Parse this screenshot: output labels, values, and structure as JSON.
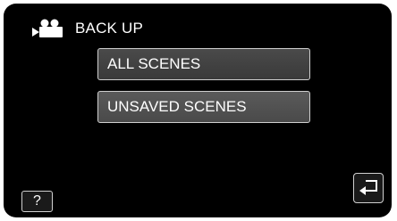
{
  "header": {
    "icon": "video-camera-icon",
    "title": "BACK UP"
  },
  "menu": {
    "items": [
      {
        "label": "ALL SCENES"
      },
      {
        "label": "UNSAVED SCENES"
      }
    ]
  },
  "help": {
    "label": "?",
    "icon": "help-icon"
  },
  "back": {
    "icon": "return-arrow-icon"
  }
}
